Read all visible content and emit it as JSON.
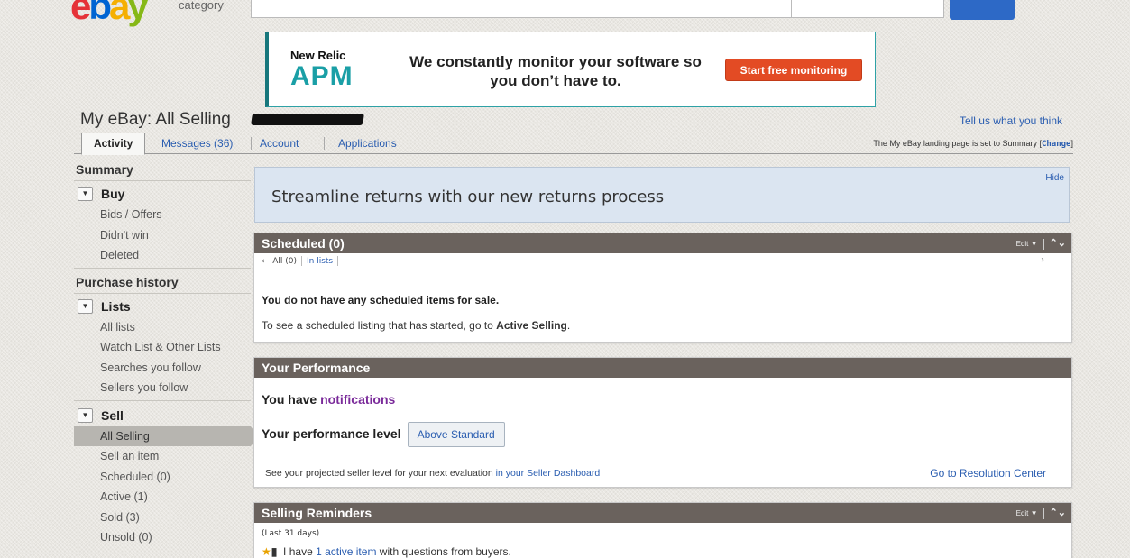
{
  "header": {
    "logo_letters": [
      "e",
      "b",
      "a",
      "y"
    ],
    "category_label": "category"
  },
  "ad": {
    "brand": "New Relic",
    "product": "APM",
    "message": "We constantly monitor your software so you don’t have to.",
    "cta": "Start free monitoring"
  },
  "page": {
    "title": "My eBay: All Selling",
    "feedback_link": "Tell us what you think",
    "landing_text": "The My eBay landing page is set to Summary [",
    "landing_change": "Change",
    "landing_close": "]"
  },
  "tabs": [
    {
      "label": "Activity",
      "active": true
    },
    {
      "label": "Messages (36)"
    },
    {
      "label": "Account"
    },
    {
      "label": "Applications"
    }
  ],
  "sidebar": {
    "summary": "Summary",
    "buy": {
      "label": "Buy",
      "items": [
        "Bids / Offers",
        "Didn't win",
        "Deleted"
      ]
    },
    "purchase_history": "Purchase history",
    "lists": {
      "label": "Lists",
      "items": [
        "All lists",
        "Watch List & Other Lists",
        "Searches you follow",
        "Sellers you follow"
      ]
    },
    "sell": {
      "label": "Sell",
      "items": [
        "All Selling",
        "Sell an item",
        "Scheduled (0)",
        "Active (1)",
        "Sold (3)",
        "Unsold (0)"
      ],
      "selected": "All Selling"
    }
  },
  "promo": {
    "text": "Streamline returns with our new returns process",
    "hide": "Hide"
  },
  "scheduled": {
    "title": "Scheduled (0)",
    "edit": "Edit",
    "filter_all": "All (0)",
    "filter_lists": "In lists",
    "empty": "You do not have any scheduled items for sale.",
    "hint_prefix": "To see a scheduled listing that has started, go to ",
    "hint_link": "Active Selling",
    "hint_suffix": "."
  },
  "performance": {
    "title": "Your Performance",
    "notif_prefix": "You have ",
    "notif_link": "notifications",
    "level_label": "Your performance level",
    "level_value": "Above Standard",
    "projected_prefix": "See your projected seller level for your next evaluation ",
    "projected_link": "in your Seller Dashboard",
    "resolution_link": "Go to Resolution Center"
  },
  "reminders": {
    "title": "Selling Reminders",
    "edit": "Edit",
    "period": "(Last 31 days)",
    "item_prefix": "I have ",
    "item_link": "1 active item",
    "item_suffix": " with questions from buyers."
  },
  "colors": {
    "panel_header": "#6a625d",
    "link": "#2a5db0",
    "notification_link": "#7a2a9a",
    "ad_cta": "#e34b24",
    "promo_bg": "#dbe5f1"
  }
}
